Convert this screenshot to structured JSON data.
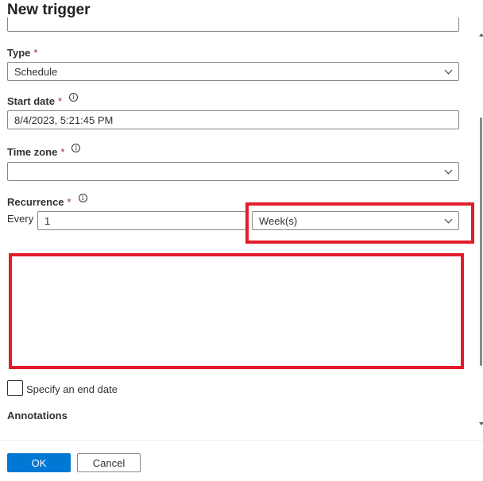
{
  "panel": {
    "title": "New trigger"
  },
  "type": {
    "label": "Type",
    "required": "*",
    "value": "Schedule"
  },
  "start_date": {
    "label": "Start date",
    "required": "*",
    "info": "i",
    "value": "8/4/2023, 5:21:45 PM"
  },
  "time_zone": {
    "label": "Time zone",
    "required": "*",
    "info": "i",
    "value": ""
  },
  "recurrence": {
    "label": "Recurrence",
    "required": "*",
    "info": "i",
    "every_label": "Every",
    "interval": "1",
    "unit": "Week(s)"
  },
  "end_date": {
    "checkbox_label": "Specify an end date"
  },
  "annotations": {
    "label": "Annotations"
  },
  "footer": {
    "ok_label": "OK",
    "cancel_label": "Cancel"
  },
  "colors": {
    "primary": "#0078d4",
    "highlight": "#e31c2b",
    "required": "#a4262c"
  }
}
